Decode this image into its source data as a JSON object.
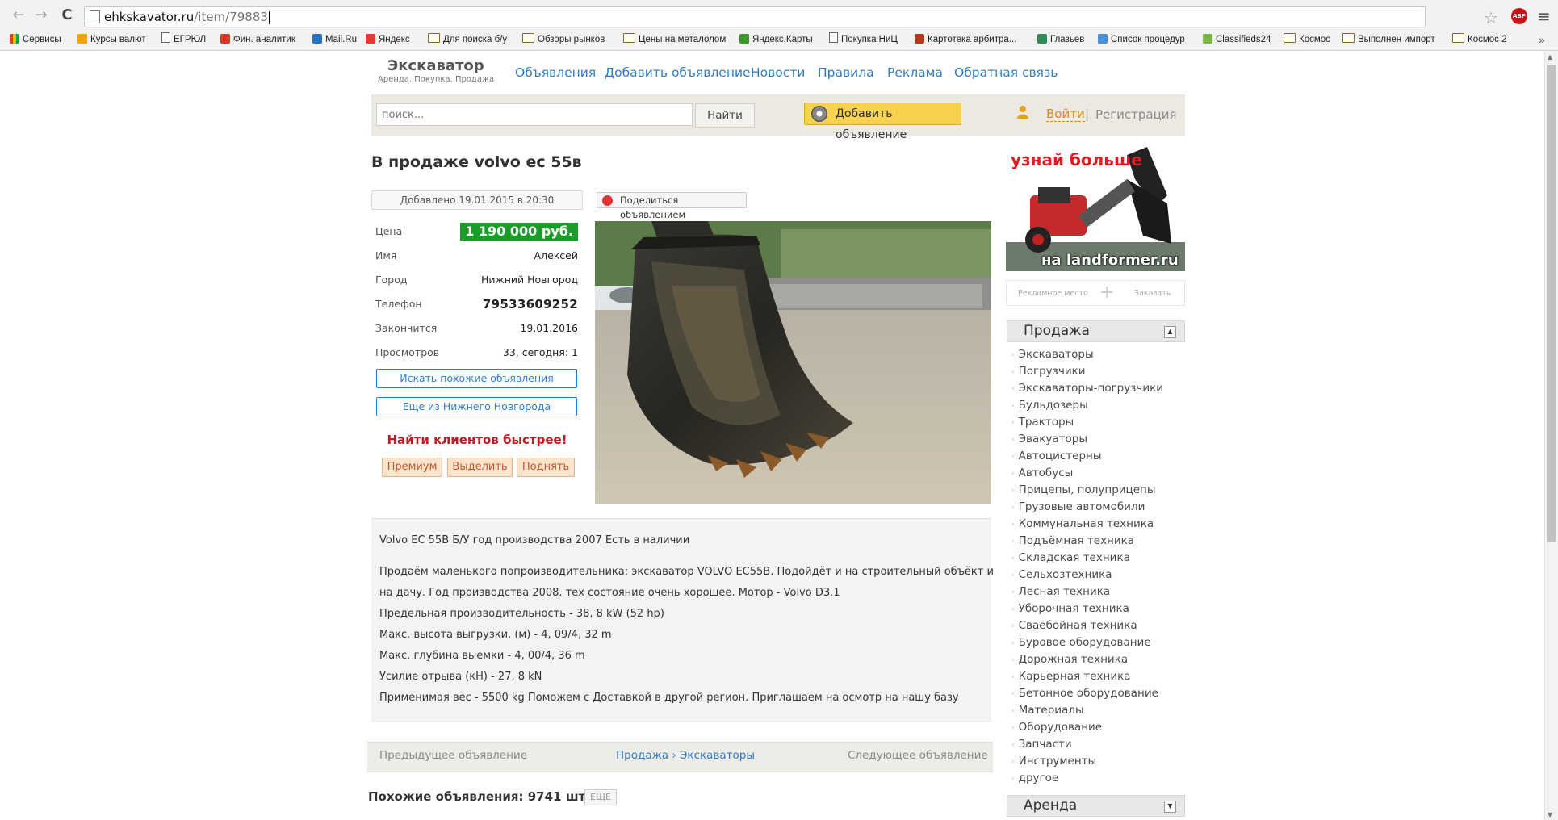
{
  "browser": {
    "url_host": "ehkskavator.ru",
    "url_path": "/item/79883",
    "bookmarks": [
      {
        "label": "Сервисы",
        "kind": "apps",
        "color": "#f4b400"
      },
      {
        "label": "Курсы валют",
        "kind": "icon",
        "color": "#f0a500"
      },
      {
        "label": "ЕГРЮЛ",
        "kind": "page",
        "color": "#666666"
      },
      {
        "label": "Фин. аналитик",
        "kind": "icon",
        "color": "#d33b27"
      },
      {
        "label": "Mail.Ru",
        "kind": "icon",
        "color": "#2a73c2"
      },
      {
        "label": "Яндекс",
        "kind": "icon",
        "color": "#e53935"
      },
      {
        "label": "Для поиска б/у",
        "kind": "folder",
        "color": ""
      },
      {
        "label": "Обзоры рынков",
        "kind": "folder",
        "color": ""
      },
      {
        "label": "Цены на металолом",
        "kind": "folder",
        "color": ""
      },
      {
        "label": "Яндекс.Карты",
        "kind": "icon",
        "color": "#3d9a2a"
      },
      {
        "label": "Покупка НиЦ",
        "kind": "page",
        "color": "#666666"
      },
      {
        "label": "Картотека арбитра...",
        "kind": "icon",
        "color": "#b33a20"
      },
      {
        "label": "Глазьев",
        "kind": "icon",
        "color": "#2e8b57"
      },
      {
        "label": "Список процедур",
        "kind": "icon",
        "color": "#4a90d9"
      },
      {
        "label": "Classifieds24",
        "kind": "icon",
        "color": "#7cb342"
      },
      {
        "label": "Космос",
        "kind": "folder",
        "color": ""
      },
      {
        "label": "Выполнен импорт",
        "kind": "folder",
        "color": ""
      },
      {
        "label": "Космос 2",
        "kind": "folder",
        "color": ""
      }
    ],
    "more_bookmarks": "»"
  },
  "site": {
    "logo_title": "Экскаватор",
    "logo_subtitle": "Аренда. Покупка. Продажа",
    "nav": [
      "Объявления",
      "Добавить объявление",
      "Новости",
      "Правила",
      "Реклама",
      "Обратная связь"
    ],
    "search_placeholder": "поиск...",
    "search_button": "Найти",
    "add_ad_button": "Добавить объявление",
    "login": "Войти",
    "separator": "|",
    "register": "Регистрация",
    "accent_color": "#2e7bc4",
    "price_color": "#1d9a2c"
  },
  "listing": {
    "title": "В продаже volvo ec 55в",
    "added": "Добавлено 19.01.2015 в 20:30",
    "share_button": "Поделиться объявлением",
    "details": [
      {
        "label": "Цена",
        "value": "1 190 000 руб."
      },
      {
        "label": "Имя",
        "value": "Алексей"
      },
      {
        "label": "Город",
        "value": "Нижний Новгород"
      },
      {
        "label": "Телефон",
        "value": "79533609252"
      },
      {
        "label": "Закончится",
        "value": "19.01.2016"
      },
      {
        "label": "Просмотров",
        "value": "33, сегодня: 1"
      }
    ],
    "search_similar_button": "Искать похожие объявления",
    "more_from_city_button": "Еще из Нижнего Новгорода",
    "find_clients_text": "Найти клиентов быстрее!",
    "promo_buttons": [
      "Премиум",
      "Выделить",
      "Поднять"
    ],
    "description": [
      "Volvo EC 55B Б/У год производства 2007 Есть в наличии",
      "Продаём маленького попроизводительника: экскаватор VOLVO EC55B. Подойдёт и на строительный объёкт и",
      "на дачу. Год производства 2008. тех состояние очень хорошее. Мотор - Volvo D3.1",
      "Предельная производительность - 38, 8 kW (52 hp)",
      "Макс. высота выгрузки, (м) - 4, 09/4, 32 m",
      "Макс. глубина выемки - 4, 00/4, 36 m",
      "Усилие отрыва (кН) - 27, 8 kN",
      "Применимая вес - 5500 kg Поможем с Доставкой в другой регион. Приглашаем на осмотр на нашу базу"
    ],
    "prev_link": "Предыдущее объявление",
    "breadcrumb": "Продажа › Экскаваторы",
    "next_link": "Следующее объявление",
    "similar_label": "Похожие объявления: 9741 шт.",
    "more_button": "ЕЩЕ"
  },
  "sidebar": {
    "banner_line1": "узнай больше",
    "banner_line2": "на landformer.ru",
    "ad_place": "Рекламное место",
    "order": "Заказать",
    "sale_header": "Продажа",
    "sale_toggle": "▲",
    "categories": [
      "Экскаваторы",
      "Погрузчики",
      "Экскаваторы-погрузчики",
      "Бульдозеры",
      "Тракторы",
      "Эвакуаторы",
      "Автоцистерны",
      "Автобусы",
      "Прицепы, полуприцепы",
      "Грузовые автомобили",
      "Коммунальная техника",
      "Подъёмная техника",
      "Складская техника",
      "Сельхозтехника",
      "Лесная техника",
      "Уборочная техника",
      "Сваебойная техника",
      "Буровое оборудование",
      "Дорожная техника",
      "Карьерная техника",
      "Бетонное оборудование",
      "Материалы",
      "Оборудование",
      "Запчасти",
      "Инструменты",
      "другое"
    ],
    "rent_header": "Аренда",
    "rent_toggle": "▼"
  }
}
